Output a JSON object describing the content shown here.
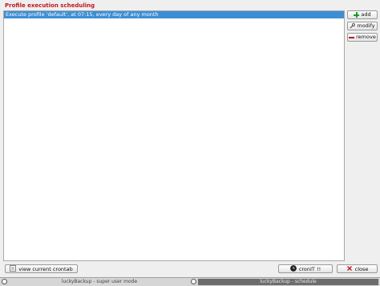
{
  "section": {
    "title": "Profile execution scheduling"
  },
  "schedule_list": {
    "items": [
      {
        "text": "Execute profile 'default', at 07:15, every day of any month",
        "selected": true
      }
    ]
  },
  "side_buttons": {
    "add": {
      "label": "add",
      "icon": "plus-icon"
    },
    "modify": {
      "label": "modify",
      "icon": "wrench-icon"
    },
    "remove": {
      "label": "remove",
      "icon": "minus-icon"
    }
  },
  "bottom_buttons": {
    "view_crontab": {
      "label": "view current crontab",
      "icon": "crontab-icon"
    },
    "cronit": {
      "label": "cronIT !!",
      "icon": "cron-icon"
    },
    "close": {
      "label": "close",
      "icon": "close-icon"
    }
  },
  "taskbar": {
    "tasks": [
      {
        "label": "luckyBackup - super user mode",
        "active": false
      },
      {
        "label": "luckyBackup - schedule",
        "active": true
      }
    ]
  },
  "colors": {
    "title_red": "#c0171d",
    "selection_blue": "#3d8ed4",
    "add_green": "#1a9b2a"
  }
}
